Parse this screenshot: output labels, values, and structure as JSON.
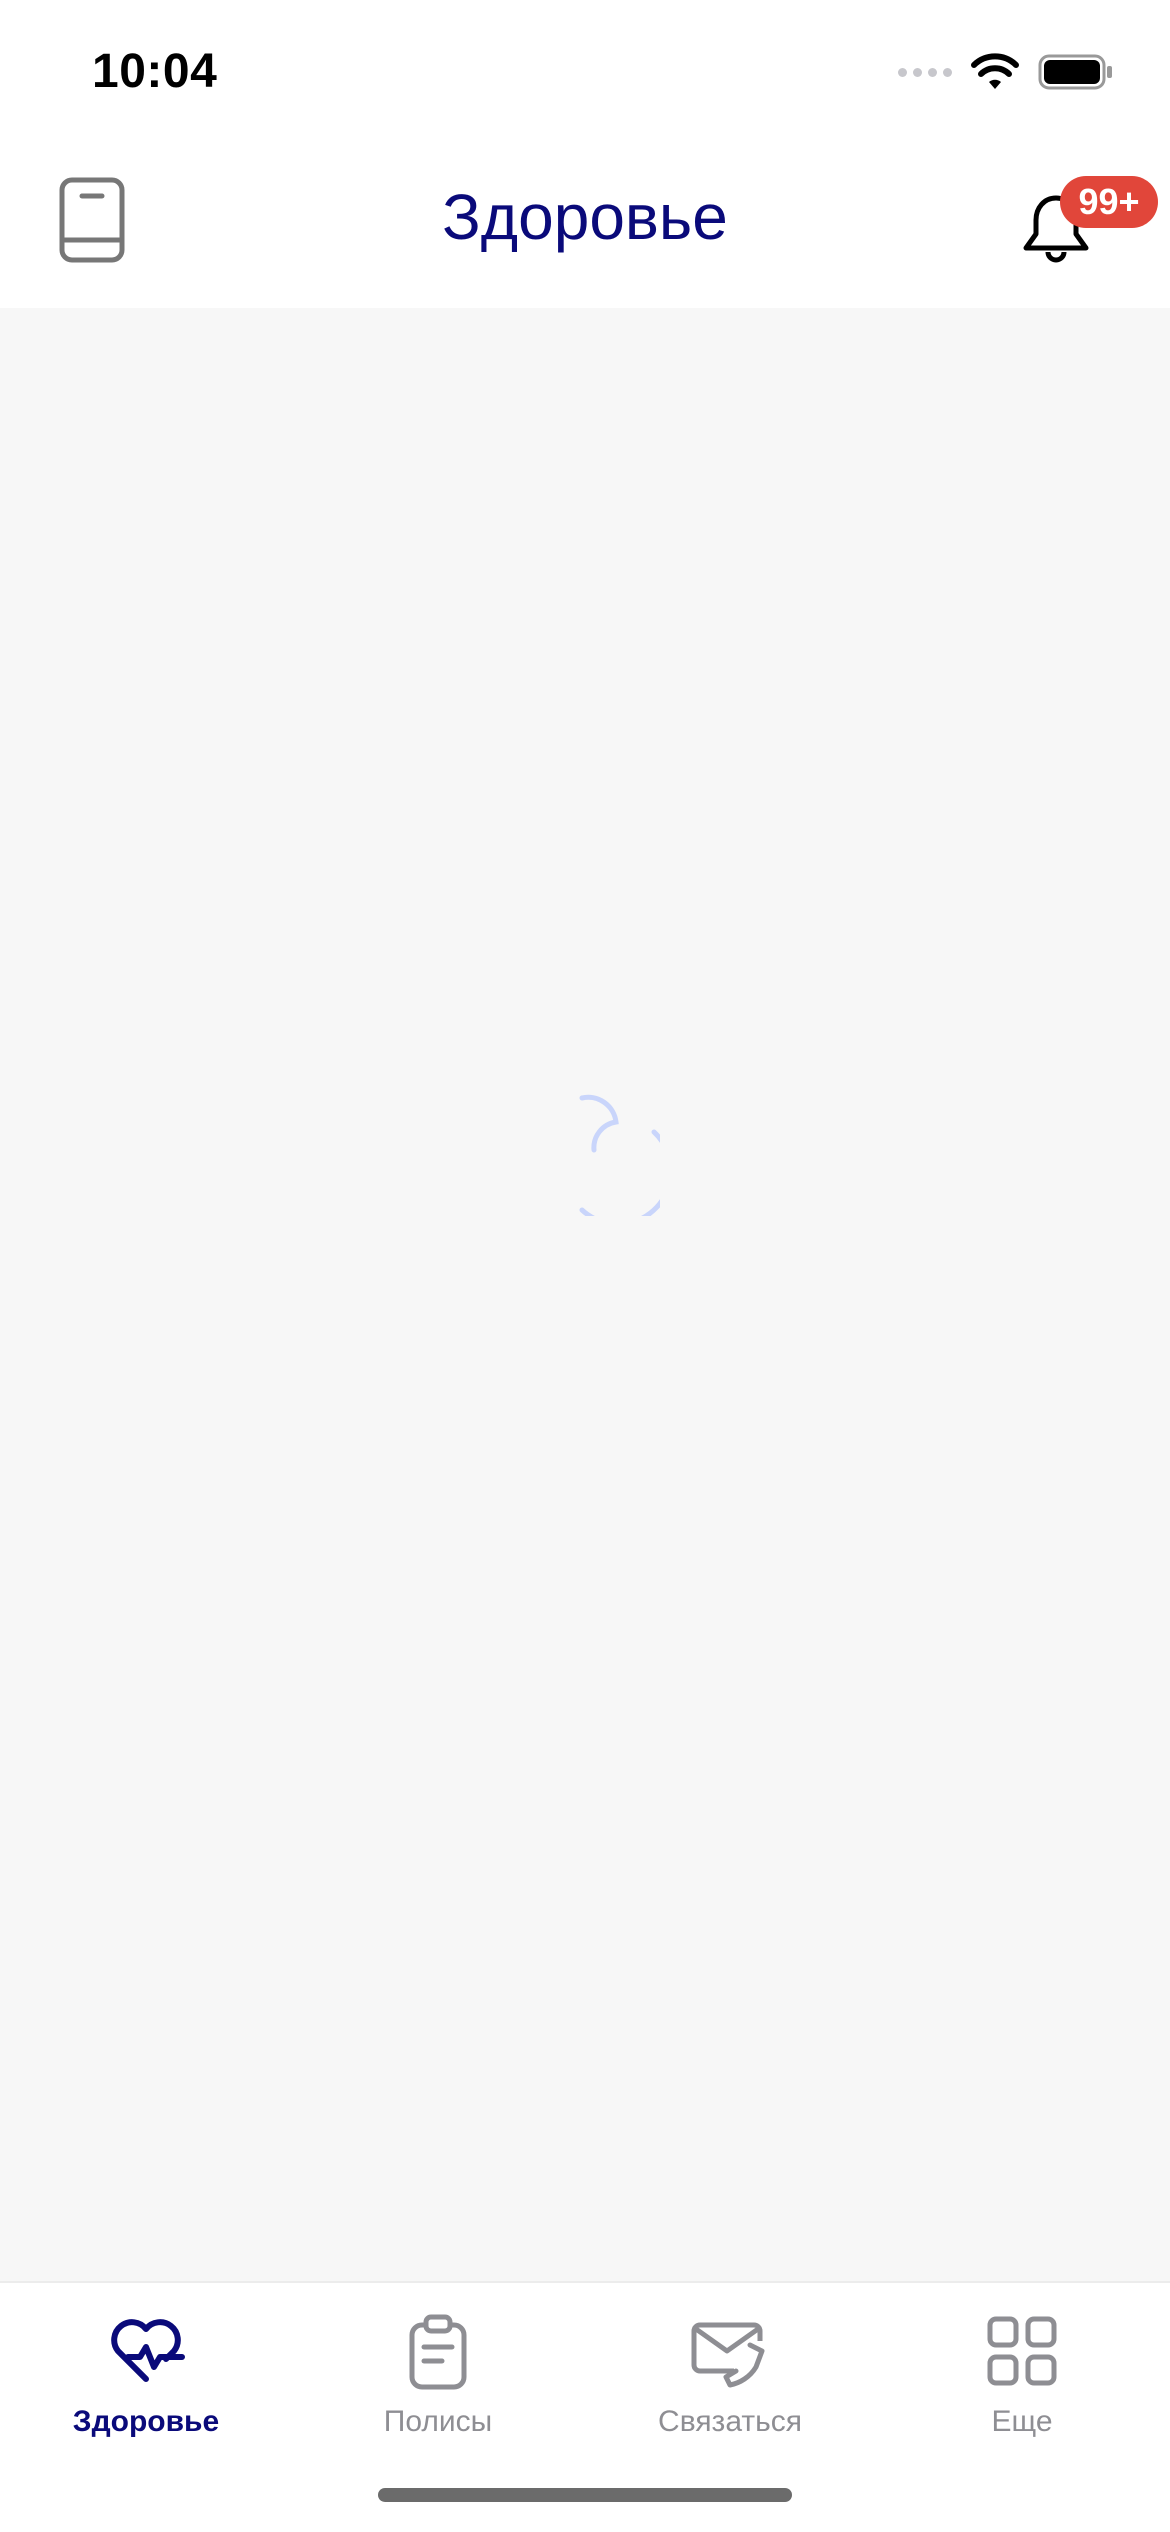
{
  "status_bar": {
    "time": "10:04",
    "signal_icon": "cellular-signal-icon",
    "wifi_icon": "wifi-icon",
    "battery_icon": "battery-icon"
  },
  "header": {
    "title": "Здоровье",
    "left_icon": "book-icon",
    "bell_icon": "bell-icon",
    "notification_badge": "99+"
  },
  "content": {
    "spinner_icon": "loading-spinner-icon"
  },
  "tab_bar": {
    "active_tab": "Здоровье",
    "tabs": [
      {
        "label": "Здоровье",
        "icon": "heart-pulse-icon"
      },
      {
        "label": "Полисы",
        "icon": "clipboard-icon"
      },
      {
        "label": "Связаться",
        "icon": "mail-phone-icon"
      },
      {
        "label": "Еще",
        "icon": "grid-icon"
      }
    ]
  },
  "colors": {
    "accent": "#0a0a7a",
    "badge": "#e1463a",
    "inactive": "#8e8e93",
    "background": "#f7f7f7",
    "spinner": "#c9d5fb"
  }
}
